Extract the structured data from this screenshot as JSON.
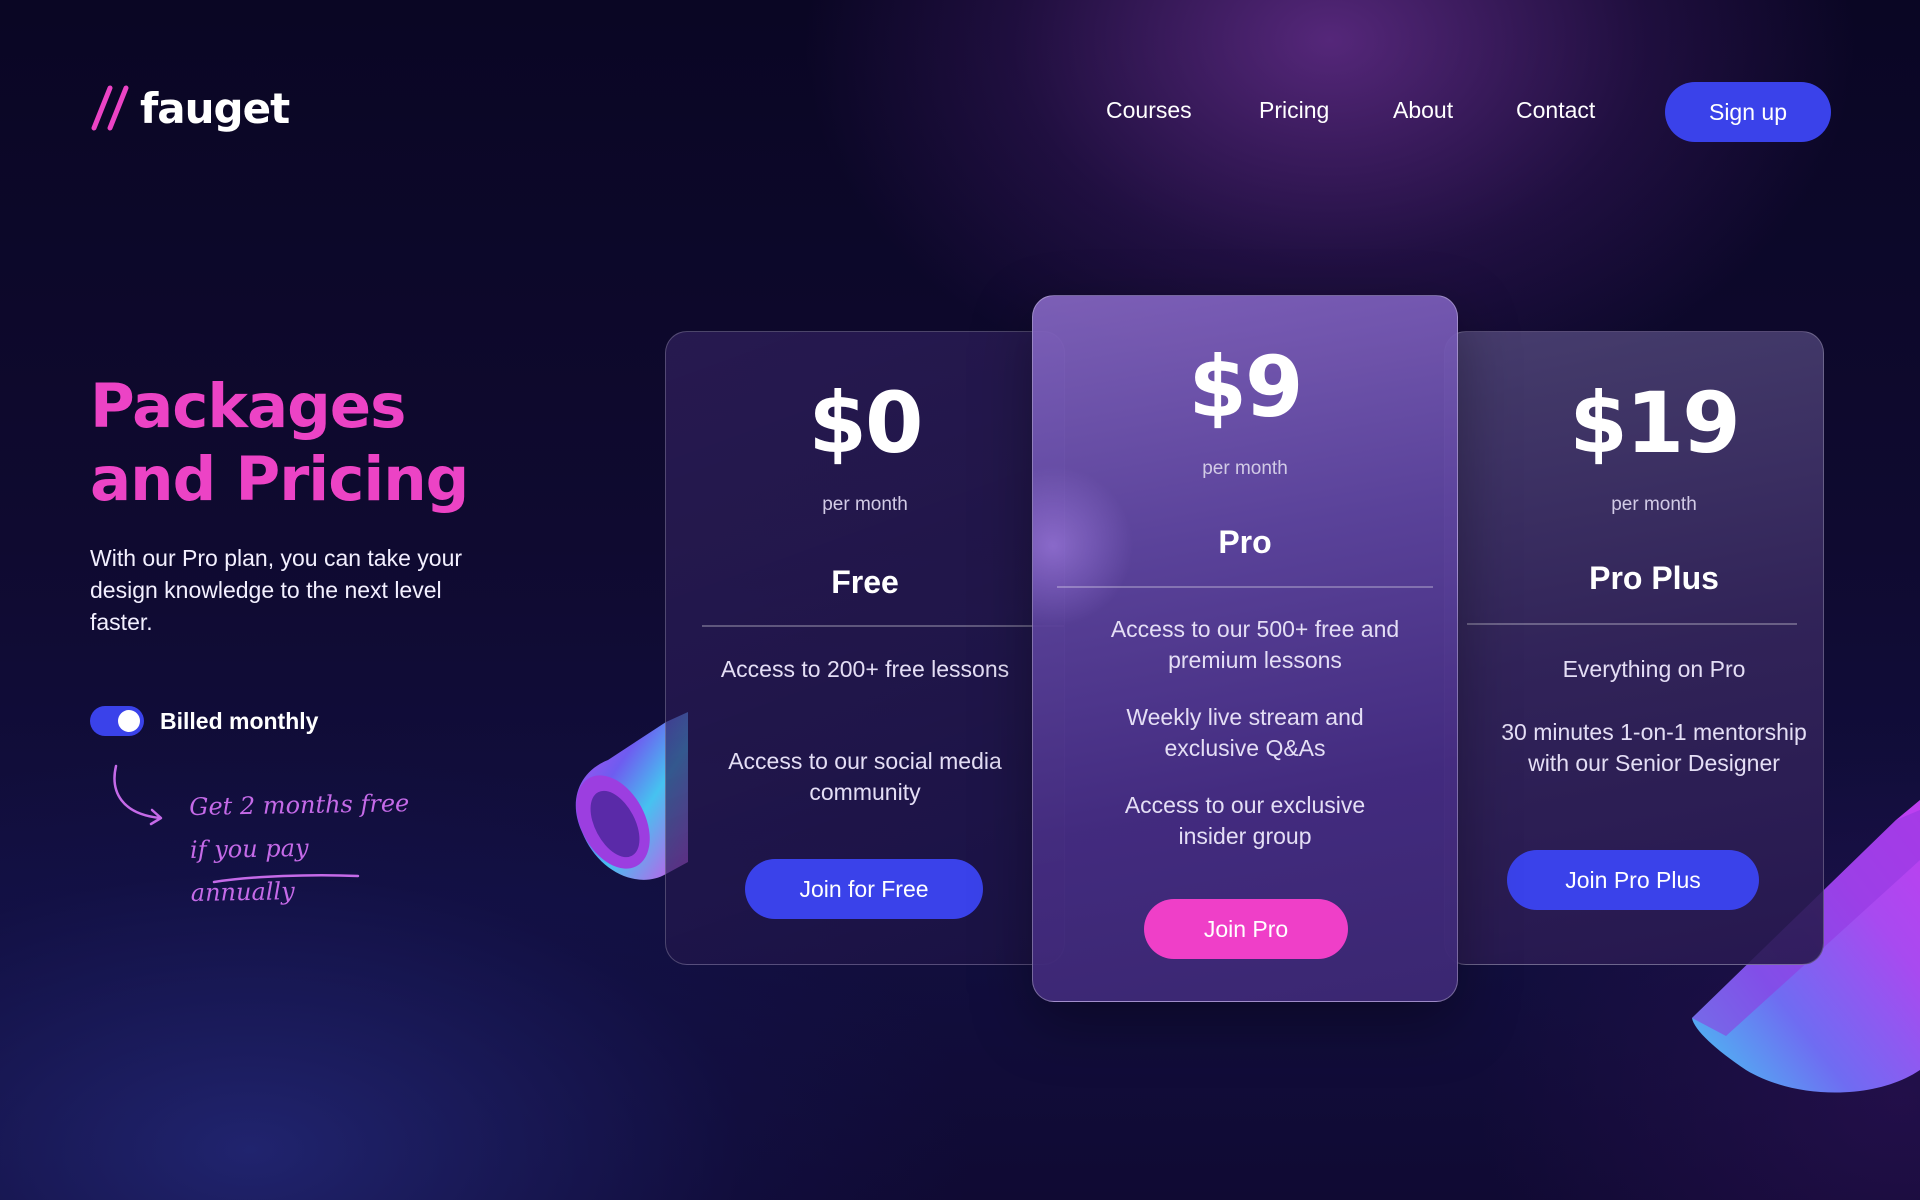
{
  "brand": {
    "name": "fauget"
  },
  "nav": {
    "links": [
      "Courses",
      "Pricing",
      "About",
      "Contact"
    ],
    "signup_label": "Sign up"
  },
  "hero": {
    "title_line1": "Packages",
    "title_line2": "and Pricing",
    "description": "With our Pro plan, you can take your design knowledge to the next level faster.",
    "billing_label": "Billed monthly",
    "billing_toggle_on": true,
    "promo_line1": "Get 2 months free",
    "promo_line2": "if you pay annually"
  },
  "plans": [
    {
      "price": "$0",
      "period": "per month",
      "name": "Free",
      "features": [
        "Access to 200+ free lessons",
        "Access to our social media community"
      ],
      "button": "Join for Free"
    },
    {
      "price": "$9",
      "period": "per month",
      "name": "Pro",
      "features": [
        "Access to our 500+ free and premium lessons",
        "Weekly live stream and exclusive Q&As",
        "Access to our exclusive insider group"
      ],
      "button": "Join Pro"
    },
    {
      "price": "$19",
      "period": "per month",
      "name": "Pro Plus",
      "features": [
        "Everything on Pro",
        "30 minutes 1-on-1 mentorship with our Senior Designer"
      ],
      "button": "Join Pro Plus"
    }
  ],
  "colors": {
    "accent_pink": "#ec43c5",
    "button_blue": "#3a42ea",
    "button_pink": "#ef3fc8",
    "background": "#0f0a30"
  },
  "icons": [
    "logo-slashes-icon",
    "curved-arrow-icon"
  ]
}
